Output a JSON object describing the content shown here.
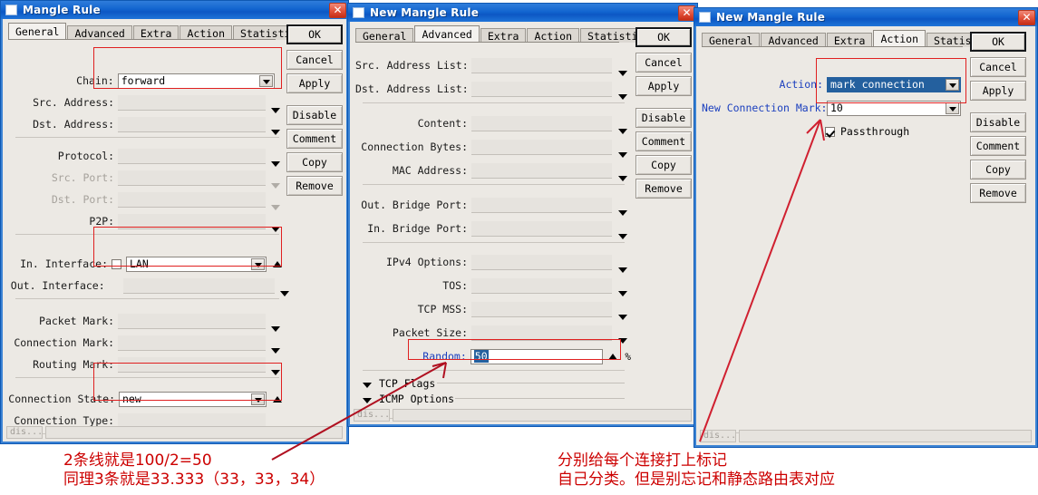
{
  "windows": [
    {
      "id": "mangle-rule",
      "title": "Mangle Rule",
      "tabs": [
        "General",
        "Advanced",
        "Extra",
        "Action",
        "Statistics"
      ],
      "active_tab": "General",
      "buttons": [
        "OK",
        "Cancel",
        "Apply",
        "Disable",
        "Comment",
        "Copy",
        "Remove"
      ],
      "status": "dis...",
      "fields": [
        {
          "label": "Chain:",
          "value": "forward"
        },
        {
          "label": "Src. Address:",
          "value": ""
        },
        {
          "label": "Dst. Address:",
          "value": ""
        },
        {
          "label": "Protocol:",
          "value": ""
        },
        {
          "label": "Src. Port:",
          "value": ""
        },
        {
          "label": "Dst. Port:",
          "value": ""
        },
        {
          "label": "P2P:",
          "value": ""
        },
        {
          "label": "In. Interface:",
          "value": "LAN"
        },
        {
          "label": "Out. Interface:",
          "value": ""
        },
        {
          "label": "Packet Mark:",
          "value": ""
        },
        {
          "label": "Connection Mark:",
          "value": ""
        },
        {
          "label": "Routing Mark:",
          "value": ""
        },
        {
          "label": "Connection State:",
          "value": "new"
        },
        {
          "label": "Connection Type:",
          "value": ""
        }
      ]
    },
    {
      "id": "new-mangle-rule-advanced",
      "title": "New Mangle Rule",
      "tabs": [
        "General",
        "Advanced",
        "Extra",
        "Action",
        "Statistics"
      ],
      "active_tab": "Advanced",
      "buttons": [
        "OK",
        "Cancel",
        "Apply",
        "Disable",
        "Comment",
        "Copy",
        "Remove"
      ],
      "status": "dis...",
      "fields": [
        {
          "label": "Src. Address List:",
          "value": ""
        },
        {
          "label": "Dst. Address List:",
          "value": ""
        },
        {
          "label": "Content:",
          "value": ""
        },
        {
          "label": "Connection Bytes:",
          "value": ""
        },
        {
          "label": "MAC Address:",
          "value": ""
        },
        {
          "label": "Out. Bridge Port:",
          "value": ""
        },
        {
          "label": "In. Bridge Port:",
          "value": ""
        },
        {
          "label": "IPv4 Options:",
          "value": ""
        },
        {
          "label": "TOS:",
          "value": ""
        },
        {
          "label": "TCP MSS:",
          "value": ""
        },
        {
          "label": "Packet Size:",
          "value": ""
        },
        {
          "label": "Random:",
          "value": "50"
        }
      ],
      "random_unit": "%",
      "collapsed_groups": [
        "TCP Flags",
        "ICMP Options"
      ]
    },
    {
      "id": "new-mangle-rule-action",
      "title": "New Mangle Rule",
      "tabs": [
        "General",
        "Advanced",
        "Extra",
        "Action",
        "Statistics"
      ],
      "active_tab": "Action",
      "buttons": [
        "OK",
        "Cancel",
        "Apply",
        "Disable",
        "Comment",
        "Copy",
        "Remove"
      ],
      "status": "dis...",
      "fields": [
        {
          "label": "Action:",
          "value": "mark connection"
        },
        {
          "label": "New Connection Mark:",
          "value": "10"
        }
      ],
      "checkbox": {
        "label": "Passthrough",
        "checked": true
      }
    }
  ],
  "annotations": {
    "left": "2条线就是100/2=50\n同理3条就是33.333（33，33，34）",
    "right": "分别给每个连接打上标记\n自己分类。但是别忘记和静态路由表对应"
  },
  "colors": {
    "title_bar": "#1265cf",
    "annotation_red": "#cc0000",
    "highlight_box": "#e02020",
    "selection_blue": "#24609e"
  }
}
